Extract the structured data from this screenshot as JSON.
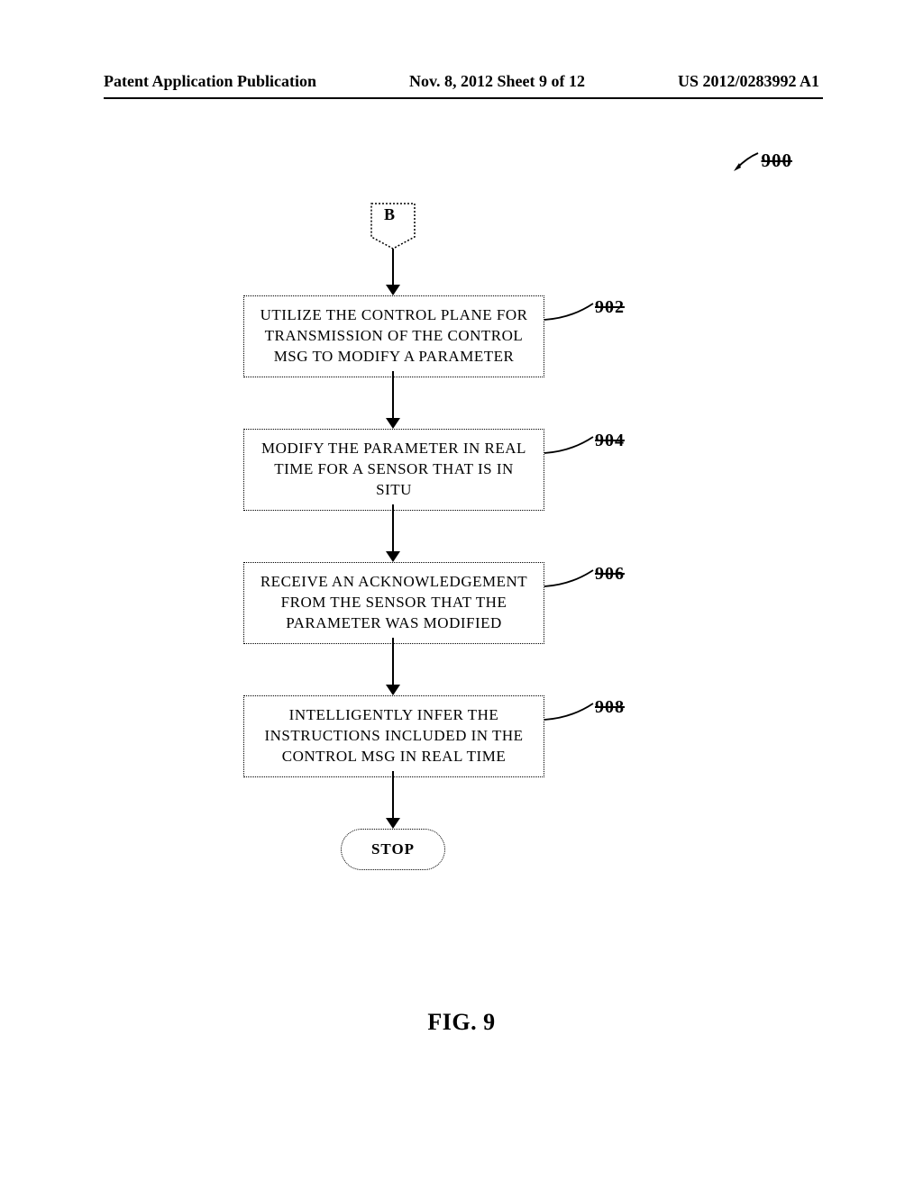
{
  "header": {
    "left": "Patent Application Publication",
    "center": "Nov. 8, 2012  Sheet 9 of 12",
    "right": "US 2012/0283992 A1"
  },
  "figure_ref": "900",
  "connector": "B",
  "steps": {
    "s902": {
      "text": "UTILIZE THE CONTROL PLANE FOR TRANSMISSION OF THE CONTROL MSG TO MODIFY A PARAMETER",
      "ref": "902"
    },
    "s904": {
      "text": "MODIFY THE PARAMETER IN REAL TIME FOR A SENSOR THAT IS IN SITU",
      "ref": "904"
    },
    "s906": {
      "text": "RECEIVE AN ACKNOWLEDGEMENT FROM THE SENSOR THAT THE PARAMETER WAS MODIFIED",
      "ref": "906"
    },
    "s908": {
      "text": "INTELLIGENTLY INFER THE INSTRUCTIONS INCLUDED IN THE CONTROL MSG IN REAL TIME",
      "ref": "908"
    }
  },
  "terminator": "STOP",
  "figure_label": "FIG. 9",
  "chart_data": {
    "type": "flowchart",
    "title": "FIG. 9",
    "reference_numeral": "900",
    "nodes": [
      {
        "id": "B",
        "type": "off-page-connector",
        "label": "B"
      },
      {
        "id": "902",
        "type": "process",
        "label": "UTILIZE THE CONTROL PLANE FOR TRANSMISSION OF THE CONTROL MSG TO MODIFY A PARAMETER"
      },
      {
        "id": "904",
        "type": "process",
        "label": "MODIFY THE PARAMETER IN REAL TIME FOR A SENSOR THAT IS IN SITU"
      },
      {
        "id": "906",
        "type": "process",
        "label": "RECEIVE AN ACKNOWLEDGEMENT FROM THE SENSOR THAT THE PARAMETER WAS MODIFIED"
      },
      {
        "id": "908",
        "type": "process",
        "label": "INTELLIGENTLY INFER THE INSTRUCTIONS INCLUDED IN THE CONTROL MSG IN REAL TIME"
      },
      {
        "id": "STOP",
        "type": "terminator",
        "label": "STOP"
      }
    ],
    "edges": [
      {
        "from": "B",
        "to": "902"
      },
      {
        "from": "902",
        "to": "904"
      },
      {
        "from": "904",
        "to": "906"
      },
      {
        "from": "906",
        "to": "908"
      },
      {
        "from": "908",
        "to": "STOP"
      }
    ]
  }
}
